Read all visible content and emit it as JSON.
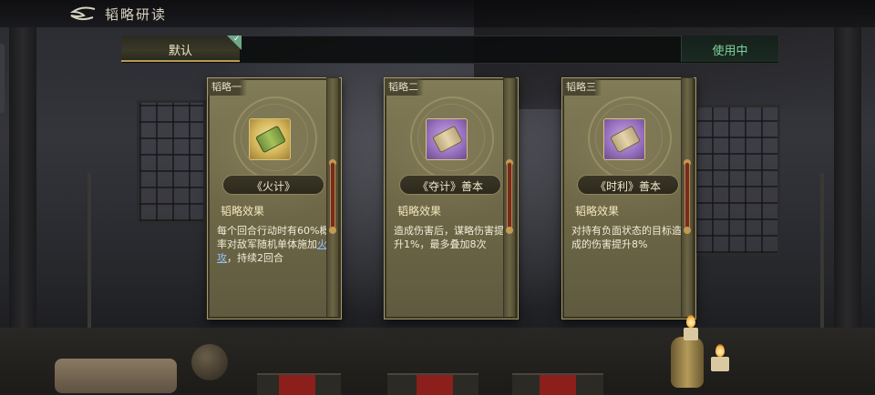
{
  "header": {
    "title": "韬略研读"
  },
  "tabs": {
    "default_label": "默认",
    "status_label": "使用中"
  },
  "cards": [
    {
      "slot_label": "韬略一",
      "name": "《火计》",
      "icon": "green-scroll-icon",
      "effect_title": "韬略效果",
      "effect_prefix": "每个回合行动时有60%概率对敌军随机单体施加",
      "effect_link": "火攻",
      "effect_suffix": "，持续2回合"
    },
    {
      "slot_label": "韬略二",
      "name": "《夺计》善本",
      "icon": "purple-scroll-icon",
      "effect_title": "韬略效果",
      "effect_text": "造成伤害后，谋略伤害提升1%，最多叠加8次"
    },
    {
      "slot_label": "韬略三",
      "name": "《时利》善本",
      "icon": "purple-scroll-icon",
      "effect_title": "韬略效果",
      "effect_text": "对持有负面状态的目标造成的伤害提升8%"
    }
  ],
  "colors": {
    "accent_gold": "#b59a55",
    "status_green": "#7fd49a",
    "link_blue": "#8fc6ff",
    "card_bg": "#726b4a"
  }
}
